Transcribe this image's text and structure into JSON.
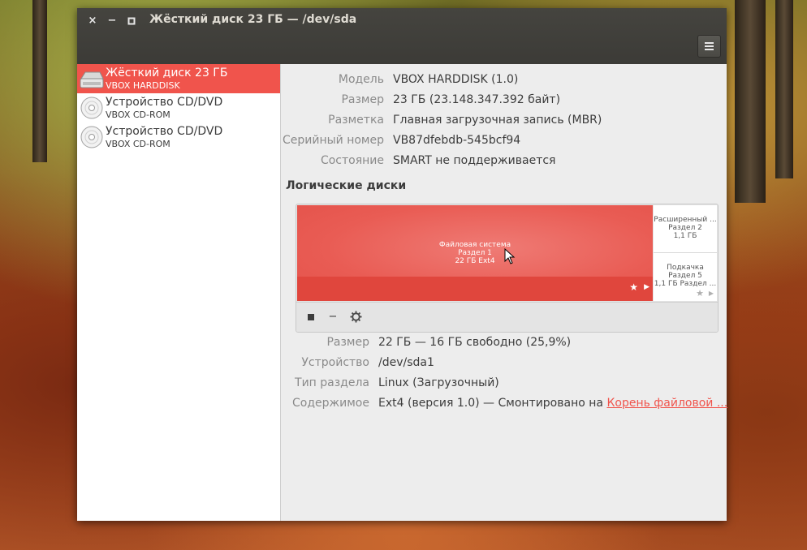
{
  "window": {
    "title": "Жёсткий диск 23 ГБ — /dev/sda",
    "controls": {
      "close": "×",
      "minimize": "−",
      "maximize": "▫"
    },
    "menu_icon": "hamburger-menu-icon"
  },
  "sidebar": {
    "items": [
      {
        "name": "Жёсткий диск 23 ГБ",
        "sub": "VBOX HARDDISK",
        "icon": "hard-disk-icon",
        "selected": true
      },
      {
        "name": "Устройство CD/DVD",
        "sub": "VBOX CD-ROM",
        "icon": "optical-disc-icon",
        "selected": false
      },
      {
        "name": "Устройство CD/DVD",
        "sub": "VBOX CD-ROM",
        "icon": "optical-disc-icon",
        "selected": false
      }
    ]
  },
  "drive_props": [
    {
      "label": "Модель",
      "value": "VBOX HARDDISK (1.0)"
    },
    {
      "label": "Размер",
      "value": "23 ГБ (23.148.347.392 байт)"
    },
    {
      "label": "Разметка",
      "value": "Главная загрузочная запись (MBR)"
    },
    {
      "label": "Серийный номер",
      "value": "VB87dfebdb-545bcf94"
    },
    {
      "label": "Состояние",
      "value": "SMART не поддерживается"
    }
  ],
  "volumes": {
    "section_title": "Логические диски",
    "main": {
      "line1": "Файловая система",
      "line2": "Раздел 1",
      "line3": "22 ГБ Ext4"
    },
    "extended": {
      "line1": "Расширенный ...",
      "line2": "Раздел 2",
      "line3": "1,1 ГБ"
    },
    "swap": {
      "line1": "Подкачка",
      "line2": "Раздел 5",
      "line3": "1,1 ГБ Раздел ..."
    },
    "toolbar": {
      "stop": "■",
      "remove": "−",
      "settings": "gear-icon"
    }
  },
  "volume_props": [
    {
      "label": "Размер",
      "value": "22 ГБ — 16 ГБ свободно (25,9%)"
    },
    {
      "label": "Устройство",
      "value": "/dev/sda1"
    },
    {
      "label": "Тип раздела",
      "value": "Linux (Загрузочный)"
    },
    {
      "label": "Содержимое",
      "value": "Ext4 (версия 1.0) — Смонтировано на",
      "link": "Корень файловой ..."
    }
  ],
  "colors": {
    "accent": "#f0544c",
    "titlebar": "#3c3b37",
    "panel": "#ededed"
  }
}
